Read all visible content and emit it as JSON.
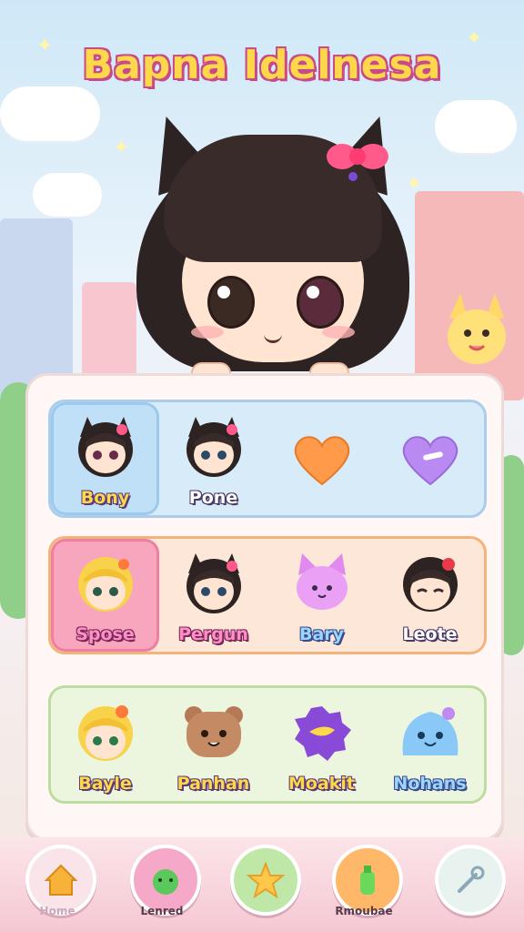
{
  "title": "Bapna Idelnesa",
  "colors": {
    "title_fill": "#ffd84a",
    "title_outline": "#c84a8a",
    "panel_bg": "#fff7f5"
  },
  "rows": [
    {
      "items": [
        {
          "label": "Bony",
          "icon": "cat-girl-avatar-icon",
          "selected": true
        },
        {
          "label": "Pone",
          "icon": "cat-girl-avatar-icon",
          "selected": false
        },
        {
          "label": "",
          "icon": "orange-heart-icon",
          "selected": false
        },
        {
          "label": "",
          "icon": "purple-heart-icon",
          "selected": false
        }
      ]
    },
    {
      "items": [
        {
          "label": "Spose",
          "icon": "blonde-girl-avatar-icon",
          "selected": true
        },
        {
          "label": "Pergun",
          "icon": "cat-girl-avatar-icon",
          "selected": false
        },
        {
          "label": "Bary",
          "icon": "purple-cat-icon",
          "selected": false
        },
        {
          "label": "Leote",
          "icon": "dark-hair-girl-avatar-icon",
          "selected": false
        }
      ]
    },
    {
      "items": [
        {
          "label": "Bayle",
          "icon": "blonde-girl-avatar-icon",
          "selected": false
        },
        {
          "label": "Panhan",
          "icon": "brown-bear-icon",
          "selected": false
        },
        {
          "label": "Moakit",
          "icon": "purple-fish-icon",
          "selected": false
        },
        {
          "label": "Nohans",
          "icon": "blue-slime-icon",
          "selected": false
        }
      ]
    }
  ],
  "nav": [
    {
      "label": "Home",
      "icon": "house-icon"
    },
    {
      "label": "Lenred",
      "icon": "green-creature-icon"
    },
    {
      "label": "",
      "icon": "star-icon"
    },
    {
      "label": "Rmoubae",
      "icon": "green-bottle-icon"
    },
    {
      "label": "",
      "icon": "wrench-icon"
    }
  ]
}
